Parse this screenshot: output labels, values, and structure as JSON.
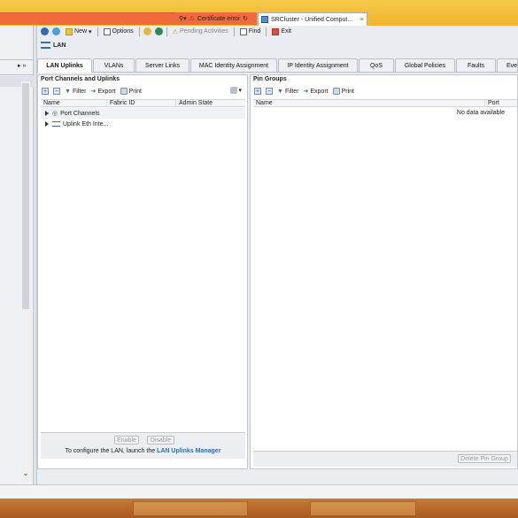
{
  "browser": {
    "cert_error": "Certificate error",
    "tab_title": "SRCluster - Unified Comput...",
    "tab_close": "×"
  },
  "toolbar": {
    "new_label": "New",
    "options_label": "Options",
    "pending_label": "Pending Activities",
    "find_label": "Find",
    "exit_label": "Exit"
  },
  "page_title": "LAN",
  "tabs": [
    "LAN Uplinks",
    "VLANs",
    "Server Links",
    "MAC Identity Assignment",
    "IP Identity Assignment",
    "QoS",
    "Global Policies",
    "Faults",
    "Eve"
  ],
  "left_panel": {
    "title": "Port Channels and Uplinks",
    "tools": {
      "filter": "Filter",
      "export": "Export",
      "print": "Print"
    },
    "columns": [
      "Name",
      "Fabric ID",
      "Admin State"
    ],
    "rows": [
      "Port Channels",
      "Uplink Eth Inte..."
    ],
    "enable_label": "Enable",
    "disable_label": "Disable",
    "hint_prefix": "To configure the LAN, launch the",
    "hint_link": "LAN Uplinks Manager"
  },
  "right_panel": {
    "title": "Pin Groups",
    "tools": {
      "filter": "Filter",
      "export": "Export",
      "print": "Print"
    },
    "columns": [
      "Name",
      "Port"
    ],
    "empty_text": "No data available",
    "delete_label": "Delete Pin Group"
  },
  "colors": {
    "link": "#1e6fd1",
    "accent": "#3a6bb5",
    "warning_bar": "#f06a3c"
  }
}
